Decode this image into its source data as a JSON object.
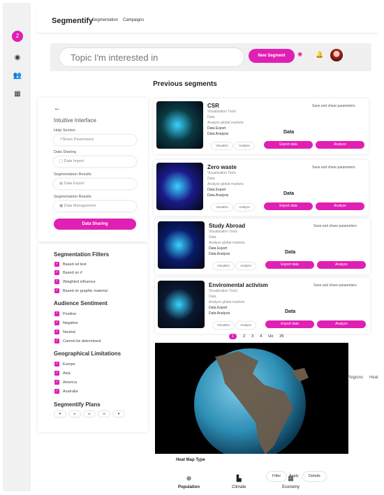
{
  "app": {
    "brand": "Segmentify",
    "nav": [
      "Segmentation",
      "Campaigns"
    ]
  },
  "rail": {
    "avatar_label": "2",
    "icons": [
      "eye-icon",
      "users-icon",
      "calendar-icon"
    ]
  },
  "header": {
    "search_placeholder": "Topic I'm interested in",
    "new_segment": "New Segment"
  },
  "section_title": "Previous segments",
  "left_panel": {
    "title": "Intuitive Interface",
    "fields": [
      {
        "label": "Help Section",
        "value": "Share Parameters",
        "icon": "share"
      },
      {
        "label": "Data Sharing",
        "value": "Data Import",
        "icon": "doc"
      },
      {
        "label": "Segmentation Results",
        "value": "Data Export",
        "icon": "export"
      },
      {
        "label": "Segmentation Results",
        "value": "Data Management",
        "icon": "grid"
      }
    ],
    "button": "Data Sharing"
  },
  "filters": {
    "groups": [
      {
        "title": "Segmentation Filters",
        "items": [
          "Based od text",
          "Based on #",
          "Weighted influence",
          "Based on graphic material"
        ]
      },
      {
        "title": "Audience Sentiment",
        "items": [
          "Positive",
          "Negative",
          "Neutral",
          "Cannot be determined"
        ]
      },
      {
        "title": "Geographical Limitations",
        "items": [
          "Europe",
          "Asia",
          "America",
          "Australia"
        ]
      }
    ],
    "plans_title": "Segmentify Plans"
  },
  "segments": [
    {
      "name": "CSR",
      "tools": "Visualization Tools",
      "data": "Data",
      "analyze": "Analyze global markets",
      "export": "Data Export",
      "analysis": "Data Analysis",
      "save": "Save and share parameters",
      "data_title": "Data",
      "visualize": "Visualize",
      "analyze_small": "Analyze",
      "export_btn": "Export data",
      "analyze_btn": "Analyze",
      "thumb": "#0b3a44"
    },
    {
      "name": "Zero waste",
      "tools": "Visualization Tools",
      "data": "Data",
      "analyze": "Analyze global markets",
      "export": "Data Export",
      "analysis": "Data Analysis",
      "save": "Save and share parameters",
      "data_title": "Data",
      "visualize": "Visualize",
      "analyze_small": "Analyze",
      "export_btn": "Export data",
      "analyze_btn": "Analyze",
      "thumb": "#1a1a8a"
    },
    {
      "name": "Study Abroad",
      "tools": "Visualization Tools",
      "data": "Data",
      "analyze": "Analyze global markets",
      "export": "Data Export",
      "analysis": "Data Analysis",
      "save": "Save and share parameters",
      "data_title": "Data",
      "visualize": "Visualize",
      "analyze_small": "Analyze",
      "export_btn": "Export data",
      "analyze_btn": "Analyze",
      "thumb": "#0a1a6a"
    },
    {
      "name": "Enviromental activism",
      "tools": "Visualization Tools",
      "data": "Data",
      "analyze": "Analyze global markets",
      "export": "Data Export",
      "analysis": "Data Analysis",
      "save": "Save and share parameters",
      "data_title": "Data",
      "visualize": "Visualize",
      "analyze_small": "Analyze",
      "export_btn": "Export data",
      "analyze_btn": "Analyze",
      "thumb": "#0a1830"
    }
  ],
  "pager": [
    "1",
    "2",
    "3",
    "4",
    "Uo",
    "25"
  ],
  "map_side": {
    "regions": "Regions",
    "heat": "Heat"
  },
  "map": {
    "label": "Heat Map Type"
  },
  "bottom_nav": {
    "population": "Population",
    "climate": "Climate",
    "economy": "Economy"
  },
  "bottom_buttons": {
    "filter": "Filter",
    "apply": "Apply",
    "details": "Details"
  },
  "colors": {
    "accent": "#e01fb4"
  }
}
